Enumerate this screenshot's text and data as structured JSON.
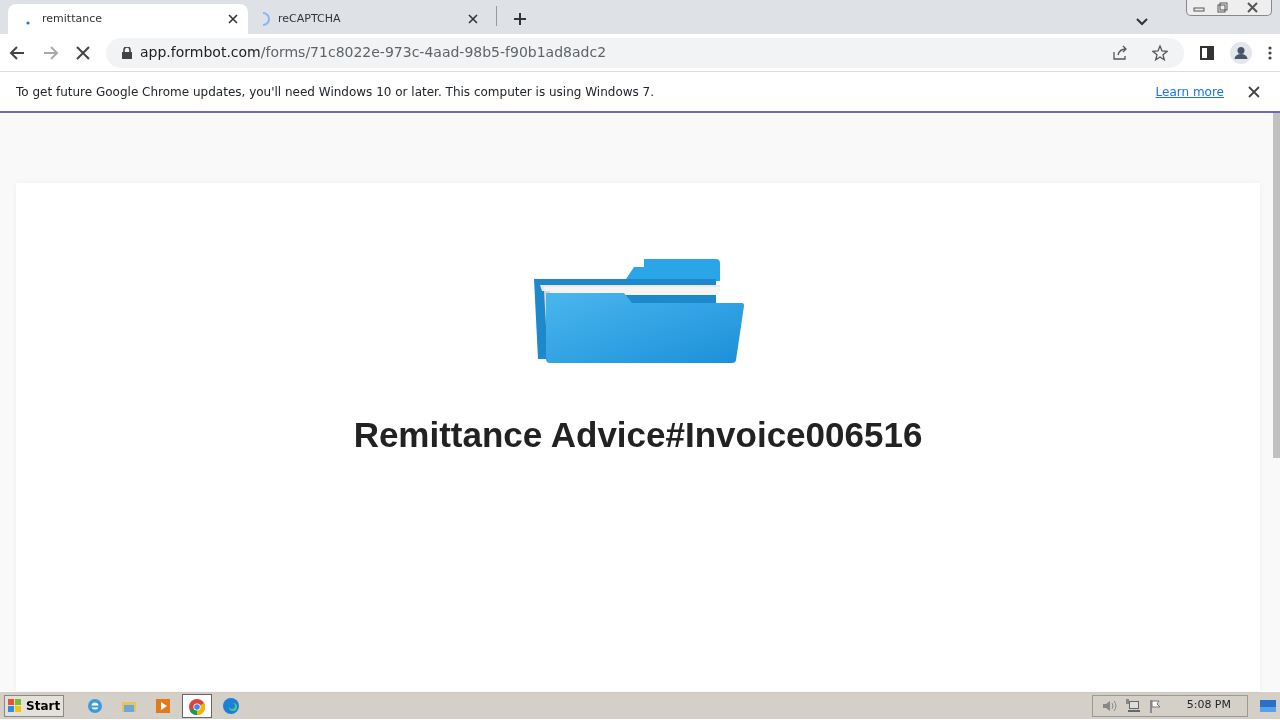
{
  "tabs": [
    {
      "title": "remittance",
      "selected": true,
      "loading": false
    },
    {
      "title": "reCAPTCHA",
      "selected": false,
      "loading": true
    }
  ],
  "address_bar": {
    "host": "app.formbot.com",
    "path": "/forms/71c8022e-973c-4aad-98b5-f90b1ad8adc2"
  },
  "info_bar": {
    "message": "To get future Google Chrome updates, you'll need Windows 10 or later. This computer is using Windows 7.",
    "link": "Learn more"
  },
  "page": {
    "heading": "Remittance Advice#Invoice006516"
  },
  "taskbar": {
    "start": "Start",
    "apps": [
      {
        "kind": "ie",
        "selected": false
      },
      {
        "kind": "explorer",
        "selected": false
      },
      {
        "kind": "media",
        "selected": false
      },
      {
        "kind": "chrome",
        "selected": true
      },
      {
        "kind": "edge",
        "selected": false
      }
    ],
    "clock": "5:08 PM"
  }
}
